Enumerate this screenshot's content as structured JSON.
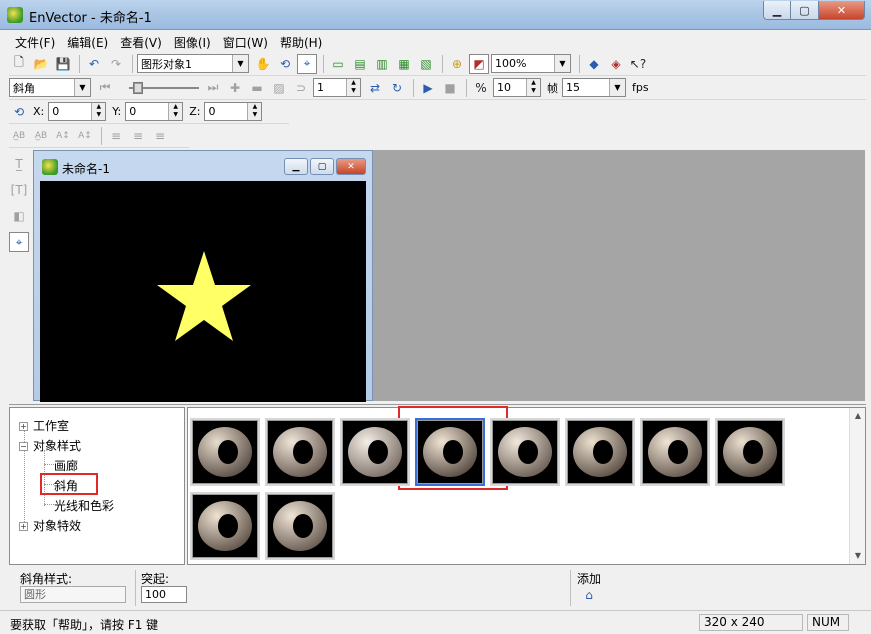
{
  "window": {
    "title": "EnVector - 未命名-1"
  },
  "menu": [
    "文件(F)",
    "编辑(E)",
    "查看(V)",
    "图像(I)",
    "窗口(W)",
    "帮助(H)"
  ],
  "toolbar": {
    "object_combo": "图形对象1",
    "zoom_combo": "100%"
  },
  "toolbar2": {
    "style_combo": "斜角",
    "frame_spin": "1",
    "speed_spin": "10",
    "frame_label": "帧",
    "fps_combo": "15",
    "fps_label": "fps"
  },
  "toolbar3": {
    "x_label": "X:",
    "x_value": "0",
    "y_label": "Y:",
    "y_value": "0",
    "z_label": "Z:",
    "z_value": "0"
  },
  "child_window": {
    "title": "未命名-1",
    "star_color": "#ffff66"
  },
  "tree": {
    "items": [
      {
        "label": "工作室",
        "expander": "+"
      },
      {
        "label": "对象样式",
        "expander": "−"
      },
      {
        "label": "画廊"
      },
      {
        "label": "斜角"
      },
      {
        "label": "光线和色彩"
      },
      {
        "label": "对象特效",
        "expander": "+"
      }
    ]
  },
  "gallery": {
    "count": 10,
    "selected_index": 3
  },
  "props": {
    "bevel_style_label": "斜角样式:",
    "bevel_style_value": "圆形",
    "raise_label": "突起:",
    "raise_value": "100",
    "add_label": "添加"
  },
  "status": {
    "help_text": "要获取「帮助」，请按 F1 键",
    "dimensions": "320 x 240",
    "num": "NUM"
  },
  "colors": {
    "highlight": "#e02a2a",
    "accent": "#3a6fd8"
  }
}
